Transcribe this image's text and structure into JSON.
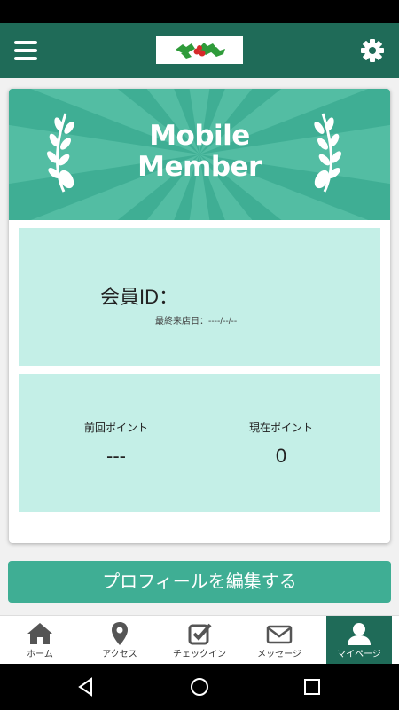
{
  "header": {
    "menu_icon": "hamburger-menu-icon",
    "logo": "holly-logo",
    "settings_icon": "gear-icon"
  },
  "banner": {
    "title_line1": "Mobile",
    "title_line2": "Member"
  },
  "member": {
    "id_label": "会員ID：",
    "last_visit": "最終来店日：----/--/--"
  },
  "points": {
    "previous_label": "前回ポイント",
    "previous_value": "---",
    "current_label": "現在ポイント",
    "current_value": "0"
  },
  "edit_profile_label": "プロフィールを編集する",
  "tabs": [
    {
      "label": "ホーム",
      "icon": "home-icon"
    },
    {
      "label": "アクセス",
      "icon": "map-pin-icon"
    },
    {
      "label": "チェックイン",
      "icon": "checkbox-icon"
    },
    {
      "label": "メッセージ",
      "icon": "mail-icon"
    },
    {
      "label": "マイページ",
      "icon": "user-icon",
      "active": true
    }
  ],
  "colors": {
    "primary_dark": "#1f6b58",
    "accent": "#3fae94",
    "panel": "#c4efe7"
  }
}
